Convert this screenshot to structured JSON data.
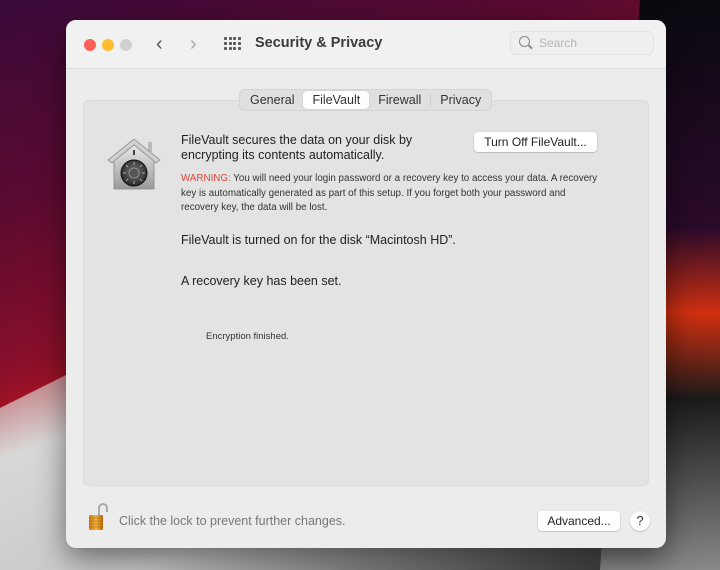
{
  "window": {
    "title": "Security & Privacy",
    "search_placeholder": "Search",
    "nav": {
      "back": "‹",
      "forward": "›"
    }
  },
  "tabs": [
    {
      "label": "General",
      "active": false
    },
    {
      "label": "FileVault",
      "active": true
    },
    {
      "label": "Firewall",
      "active": false
    },
    {
      "label": "Privacy",
      "active": false
    }
  ],
  "filevault": {
    "description": "FileVault secures the data on your disk by encrypting its contents automatically.",
    "turn_off_label": "Turn Off FileVault...",
    "warning_label": "WARNING:",
    "warning_text": " You will need your login password or a recovery key to access your data. A recovery key is automatically generated as part of this setup. If you forget both your password and recovery key, the data will be lost.",
    "status_disk": "FileVault is turned on for the disk “Macintosh HD”.",
    "status_recovery": "A recovery key has been set.",
    "status_encryption": "Encryption finished."
  },
  "footer": {
    "lock_text": "Click the lock to prevent further changes.",
    "advanced_label": "Advanced...",
    "help_label": "?"
  },
  "colors": {
    "close": "#fe5f57",
    "minimize": "#febc2e",
    "zoom_disabled": "#d0d0d0",
    "warning": "#e0453a"
  }
}
